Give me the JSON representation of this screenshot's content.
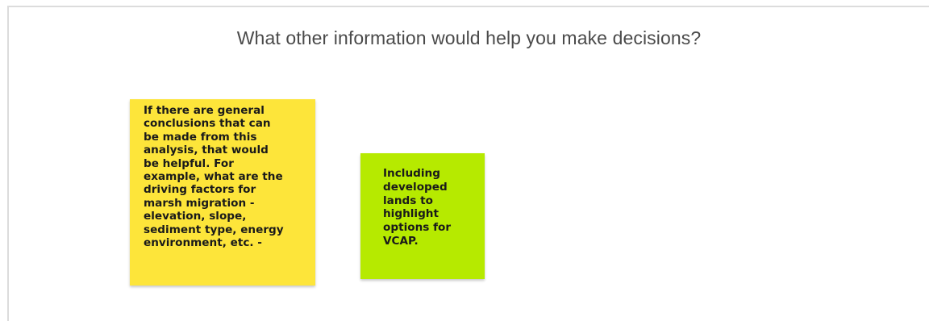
{
  "frame": {
    "title": "What other information would help you make decisions?"
  },
  "sticky_notes": [
    {
      "color": "#fde53a",
      "text": "If there are general\nconclusions that can\nbe made from this\nanalysis, that would\nbe helpful. For\nexample, what are the\ndriving factors for\nmarsh migration -\nelevation, slope,\nsediment type, energy\nenvironment, etc. -"
    },
    {
      "color": "#b6ea00",
      "text": "Including\ndeveloped\nlands to\nhighlight\noptions for\nVCAP."
    }
  ]
}
